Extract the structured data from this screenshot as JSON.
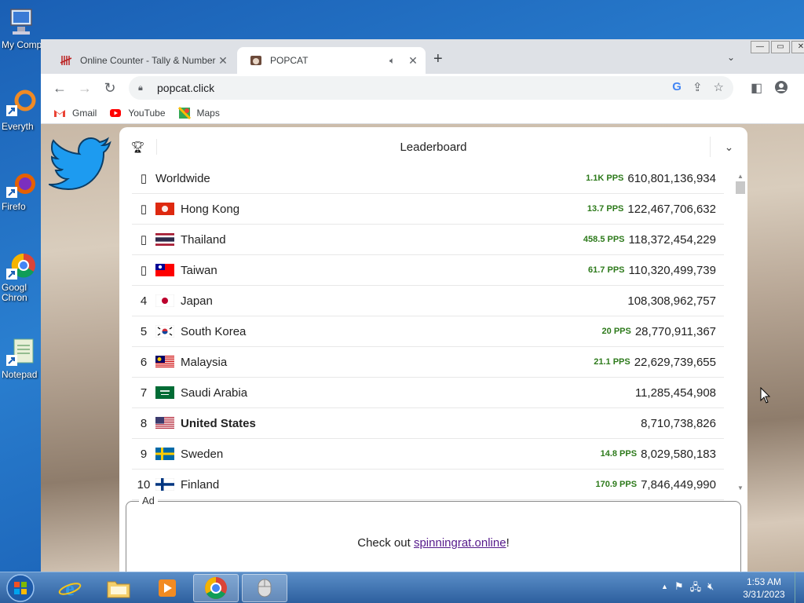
{
  "desktop": {
    "icons": [
      {
        "label": "My Comp"
      },
      {
        "label": "Everyth"
      },
      {
        "label": "Firefo"
      },
      {
        "label": "Googl Chron"
      },
      {
        "label": "Notepad"
      }
    ]
  },
  "browser": {
    "tabs": [
      {
        "title": "Online Counter - Tally & Number",
        "active": false
      },
      {
        "title": "POPCAT",
        "active": true
      }
    ],
    "new_tab": "+",
    "url": "popcat.click",
    "bookmarks": [
      {
        "label": "Gmail"
      },
      {
        "label": "YouTube"
      },
      {
        "label": "Maps"
      }
    ]
  },
  "leaderboard": {
    "title": "Leaderboard",
    "rows": [
      {
        "rank": "",
        "name": "Worldwide",
        "pps": "1.1K PPS",
        "score": "610,801,136,934",
        "flag": "none"
      },
      {
        "rank": "",
        "name": "Hong Kong",
        "pps": "13.7 PPS",
        "score": "122,467,706,632",
        "flag": "hk"
      },
      {
        "rank": "",
        "name": "Thailand",
        "pps": "458.5 PPS",
        "score": "118,372,454,229",
        "flag": "th"
      },
      {
        "rank": "",
        "name": "Taiwan",
        "pps": "61.7 PPS",
        "score": "110,320,499,739",
        "flag": "tw"
      },
      {
        "rank": "4",
        "name": "Japan",
        "pps": "",
        "score": "108,308,962,757",
        "flag": "jp"
      },
      {
        "rank": "5",
        "name": "South Korea",
        "pps": "20 PPS",
        "score": "28,770,911,367",
        "flag": "kr"
      },
      {
        "rank": "6",
        "name": "Malaysia",
        "pps": "21.1 PPS",
        "score": "22,629,739,655",
        "flag": "my"
      },
      {
        "rank": "7",
        "name": "Saudi Arabia",
        "pps": "",
        "score": "11,285,454,908",
        "flag": "sa"
      },
      {
        "rank": "8",
        "name": "United States",
        "pps": "",
        "score": "8,710,738,826",
        "flag": "us",
        "bold": true
      },
      {
        "rank": "9",
        "name": "Sweden",
        "pps": "14.8 PPS",
        "score": "8,029,580,183",
        "flag": "se"
      },
      {
        "rank": "10",
        "name": "Finland",
        "pps": "170.9 PPS",
        "score": "7,846,449,990",
        "flag": "fi"
      }
    ]
  },
  "ad": {
    "label": "Ad",
    "text_prefix": "Check out ",
    "link_text": "spinningrat.online",
    "text_suffix": "!"
  },
  "taskbar": {
    "time": "1:53 AM",
    "date": "3/31/2023"
  }
}
